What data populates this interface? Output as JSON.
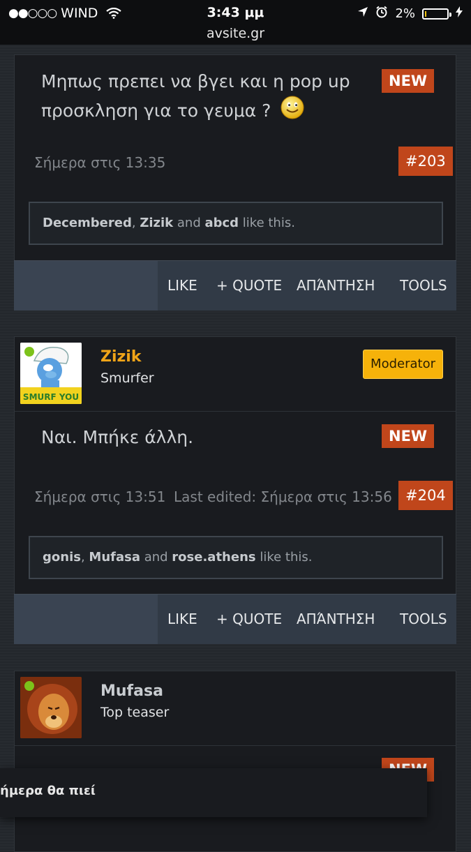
{
  "status_bar": {
    "carrier": "WIND",
    "signal": "●●○○○",
    "time": "3:43 μμ",
    "url": "avsite.gr",
    "battery": "2%",
    "battery_fraction": 0.02
  },
  "posts": [
    {
      "text_line1": "Μηπως πρεπει να βγει και η pop up",
      "text_line2": "προσκληση για το γευμα ?",
      "new_label": "NEW",
      "date": "Σήμερα στις 13:35",
      "number": "#203",
      "likers": [
        "Decembered",
        "Zizik",
        "abcd"
      ],
      "likes_sep": ", ",
      "likes_and": " and ",
      "likes_suffix": " like this."
    },
    {
      "username": "Zizik",
      "user_title": "Smurfer",
      "role": "Moderator",
      "text": "Ναι. Μπήκε άλλη.",
      "new_label": "NEW",
      "date": "Σήμερα στις 13:51",
      "edited": "Last edited: Σήμερα στις 13:56",
      "number": "#204",
      "likers": [
        "gonis",
        "Mufasa",
        "rose.athens"
      ],
      "likes_sep": ", ",
      "likes_and": " and ",
      "likes_suffix": " like this."
    },
    {
      "username": "Mufasa",
      "user_title": "Top teaser",
      "new_label": "NEW"
    }
  ],
  "toolbar": {
    "like": "LIKE",
    "quote": "+ QUOTE",
    "reply": "ΑΠΆΝΤΗΣΗ",
    "tools": "TOOLS"
  },
  "avatar_text": "SMURF YOU",
  "toast": "ήμερα θα πιεί",
  "colors": {
    "accent_new": "#c0461b",
    "moderator": "#f6b20a",
    "username_moderator": "#f0a418",
    "username_regular": "#c8ccd0",
    "online": "#7cc21a"
  }
}
